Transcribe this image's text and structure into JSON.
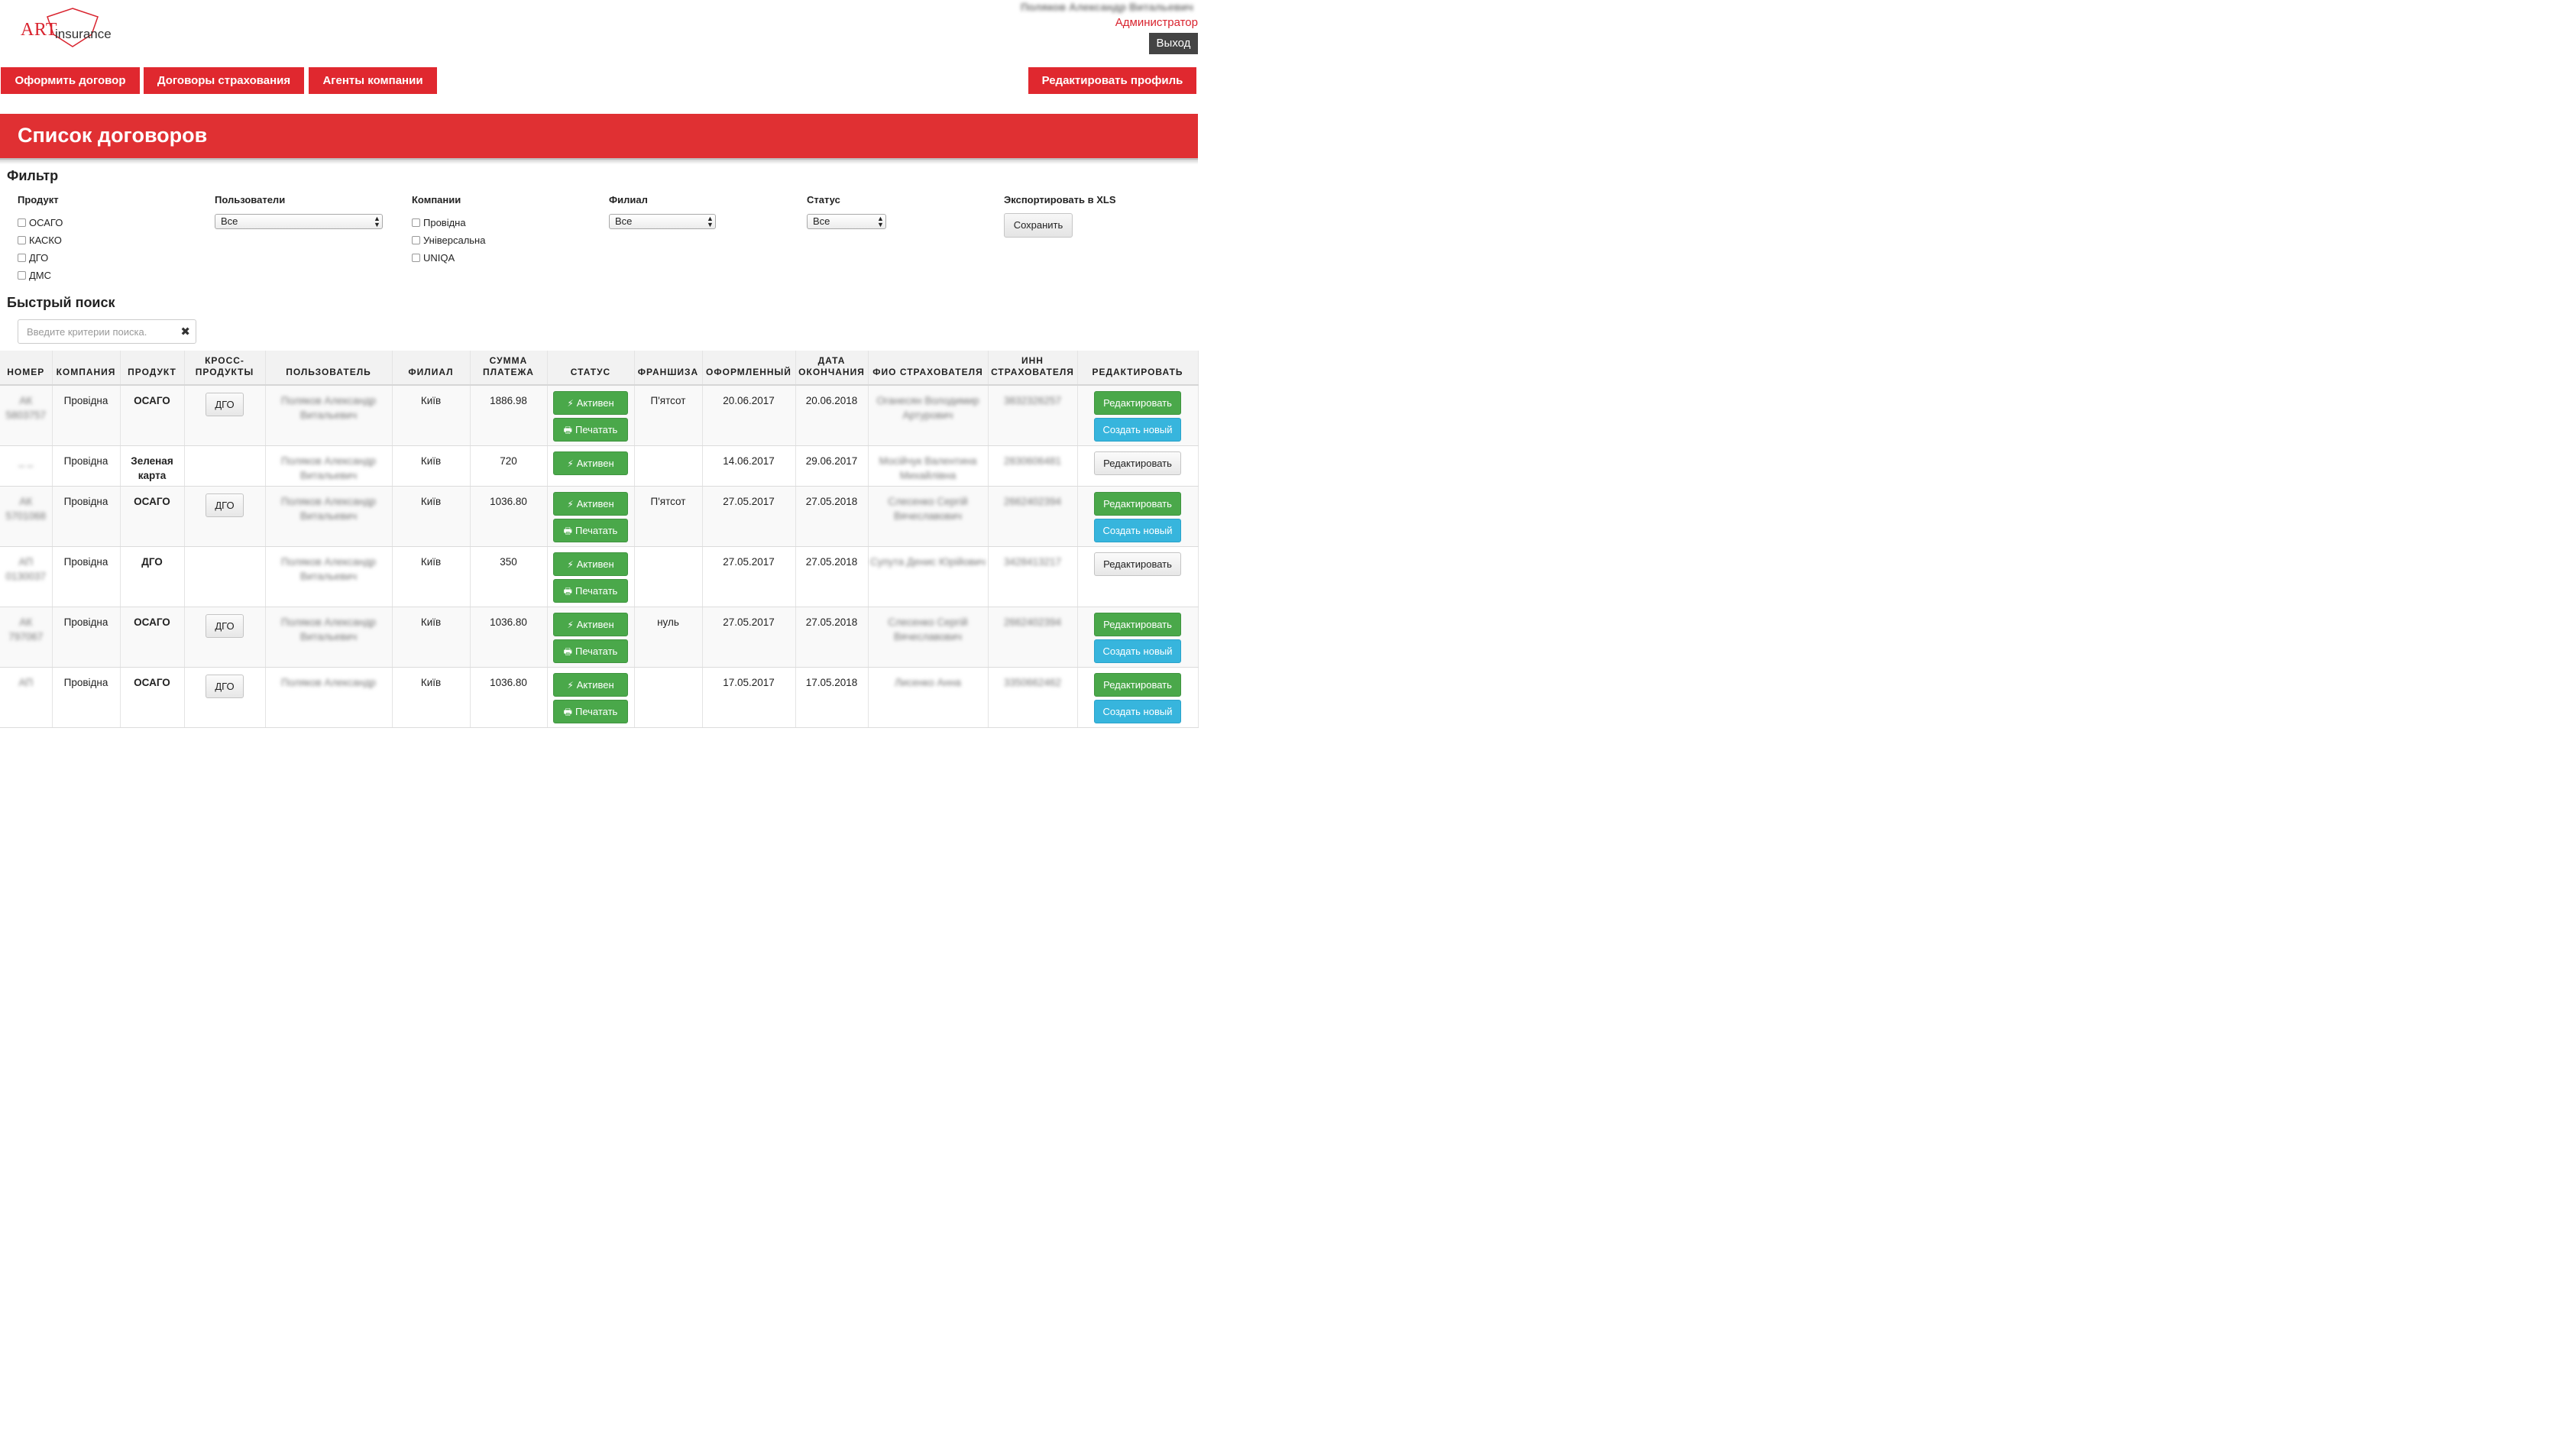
{
  "header": {
    "logo_art": "ART",
    "logo_insurance": "insurance",
    "user_name": "Поляков Александр Витальевич",
    "user_role": "Администратор",
    "logout": "Выход"
  },
  "nav": {
    "create_contract": "Оформить договор",
    "contracts": "Договоры страхования",
    "agents": "Агенты компании",
    "edit_profile": "Редактировать профиль"
  },
  "page_title": "Список договоров",
  "filter": {
    "title": "Фильтр",
    "product_label": "Продукт",
    "products": [
      "ОСАГО",
      "КАСКО",
      "ДГО",
      "ДМС"
    ],
    "users_label": "Пользователи",
    "users_value": "Все",
    "companies_label": "Компании",
    "companies": [
      "Провідна",
      "Універсальна",
      "UNIQA"
    ],
    "branch_label": "Филиал",
    "branch_value": "Все",
    "status_label": "Статус",
    "status_value": "Все",
    "export_label": "Экспортировать в XLS",
    "save_button": "Сохранить"
  },
  "search": {
    "title": "Быстрый поиск",
    "placeholder": "Введите критерии поиска."
  },
  "table": {
    "headers": {
      "number": "Номер",
      "company": "Компания",
      "product": "Продукт",
      "cross": "Кросс-продукты",
      "user": "Пользователь",
      "branch": "Филиал",
      "amount": "Сумма платежа",
      "status": "Статус",
      "franchise": "Франшиза",
      "issued": "Оформленный",
      "end_date": "Дата окончания",
      "insurer_name": "ФИО страхователя",
      "insurer_inn": "ИНН страхователя",
      "edit": "Редактировать"
    },
    "labels": {
      "active": "Активен",
      "print": "Печатать",
      "edit": "Редактировать",
      "create_new": "Создать новый"
    },
    "rows": [
      {
        "number": "АК 5803757",
        "company": "Провідна",
        "product": "ОСАГО",
        "cross": "ДГО",
        "user": "Поляков Александр Витальевич",
        "branch": "Київ",
        "amount": "1886.98",
        "franchise": "П'ятсот",
        "issued": "20.06.2017",
        "end_date": "20.06.2018",
        "insurer_name": "Оганесян Володимир Артурович",
        "insurer_inn": "3832326257"
      },
      {
        "number": "_ _",
        "company": "Провідна",
        "product": "Зеленая карта",
        "cross": "",
        "user": "Поляков Александр Витальевич",
        "branch": "Київ",
        "amount": "720",
        "franchise": "",
        "issued": "14.06.2017",
        "end_date": "29.06.2017",
        "insurer_name": "Мосійчук Валентина Михайлівна",
        "insurer_inn": "2830606481"
      },
      {
        "number": "АК 5701068",
        "company": "Провідна",
        "product": "ОСАГО",
        "cross": "ДГО",
        "user": "Поляков Александр Витальевич",
        "branch": "Київ",
        "amount": "1036.80",
        "franchise": "П'ятсот",
        "issued": "27.05.2017",
        "end_date": "27.05.2018",
        "insurer_name": "Слесенко Сергій Вячеславович",
        "insurer_inn": "2662402394"
      },
      {
        "number": "АП 0130037",
        "company": "Провідна",
        "product": "ДГО",
        "cross": "",
        "user": "Поляков Александр Витальевич",
        "branch": "Київ",
        "amount": "350",
        "franchise": "",
        "issued": "27.05.2017",
        "end_date": "27.05.2018",
        "insurer_name": "Супута Денис Юрійович",
        "insurer_inn": "3428413217"
      },
      {
        "number": "АК 797067",
        "company": "Провідна",
        "product": "ОСАГО",
        "cross": "ДГО",
        "user": "Поляков Александр Витальевич",
        "branch": "Київ",
        "amount": "1036.80",
        "franchise": "нуль",
        "issued": "27.05.2017",
        "end_date": "27.05.2018",
        "insurer_name": "Слесенко Сергій Вячеславович",
        "insurer_inn": "2662402394"
      },
      {
        "number": "АП",
        "company": "Провідна",
        "product": "ОСАГО",
        "cross": "ДГО",
        "user": "Поляков Александр",
        "branch": "Київ",
        "amount": "1036.80",
        "franchise": "",
        "issued": "17.05.2017",
        "end_date": "17.05.2018",
        "insurer_name": "Лисенко Анна",
        "insurer_inn": "3350662462"
      }
    ]
  },
  "colors": {
    "brand_red": "#e0282f",
    "success_green": "#4aa84a",
    "info_blue": "#37b5dd",
    "logout_dark": "#444444"
  }
}
